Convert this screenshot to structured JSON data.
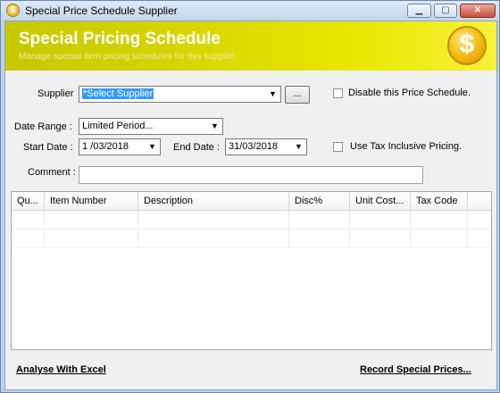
{
  "window": {
    "title": "Special Price Schedule Supplier",
    "min_symbol": "▁",
    "max_symbol": "▢",
    "close_symbol": "✕",
    "icon_symbol": "$"
  },
  "banner": {
    "title": "Special Pricing Schedule",
    "subtitle": "Manage special item pricing schedules for this supplier.",
    "coin_symbol": "$"
  },
  "form": {
    "supplier_label": "Supplier",
    "supplier_value": "*Select Supplier",
    "browse_label": "...",
    "disable_label": "Disable this Price Schedule.",
    "date_range_label": "Date Range :",
    "date_range_value": "Limited Period...",
    "start_date_label": "Start Date :",
    "start_date_value": "1 /03/2018",
    "end_date_label": "End Date :",
    "end_date_value": "31/03/2018",
    "tax_inclusive_label": "Use Tax Inclusive Pricing.",
    "comment_label": "Comment :",
    "comment_value": "",
    "dropdown_arrow": "▼"
  },
  "grid": {
    "columns": [
      "Qu...",
      "Item Number",
      "Description",
      "Disc%",
      "Unit Cost...",
      "Tax Code"
    ]
  },
  "footer": {
    "analyse_label": "Analyse With Excel",
    "record_label": "Record Special Prices..."
  }
}
